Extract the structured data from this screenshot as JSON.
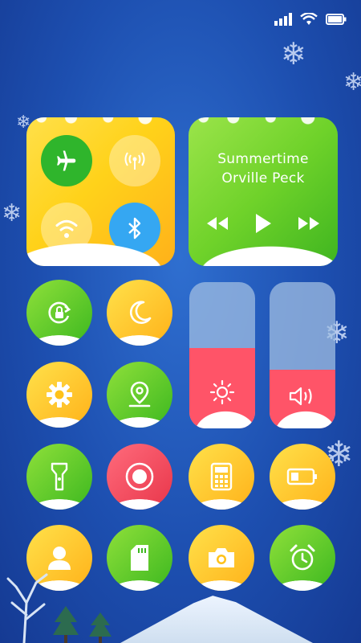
{
  "status_bar": {
    "icons": [
      "signal-icon",
      "wifi-icon",
      "battery-icon"
    ]
  },
  "connectivity_tile": {
    "buttons": [
      {
        "name": "airplane-mode",
        "active": true,
        "color": "#2fb52c"
      },
      {
        "name": "cellular-data",
        "active": false
      },
      {
        "name": "wifi",
        "active": false
      },
      {
        "name": "bluetooth",
        "active": true,
        "color": "#35a7f2"
      }
    ]
  },
  "music_tile": {
    "song": "Summertime",
    "artist": "Orville Peck",
    "controls": [
      "rewind-icon",
      "play-icon",
      "fast-forward-icon"
    ]
  },
  "sliders": [
    {
      "name": "brightness",
      "level": 0.55
    },
    {
      "name": "volume",
      "level": 0.4
    }
  ],
  "row_buttons": [
    [
      "rotation-lock",
      "night-mode"
    ],
    [
      "settings",
      "location"
    ],
    [
      "flashlight",
      "screen-record",
      "calculator",
      "battery-saver"
    ],
    [
      "contacts",
      "sd-card",
      "camera",
      "alarm-clock"
    ]
  ],
  "colors": {
    "green": "#3db820",
    "yellow": "#ffc21a",
    "red": "#e8364a",
    "slider_fill": "#ff5468",
    "background": "#1d4fb0"
  }
}
